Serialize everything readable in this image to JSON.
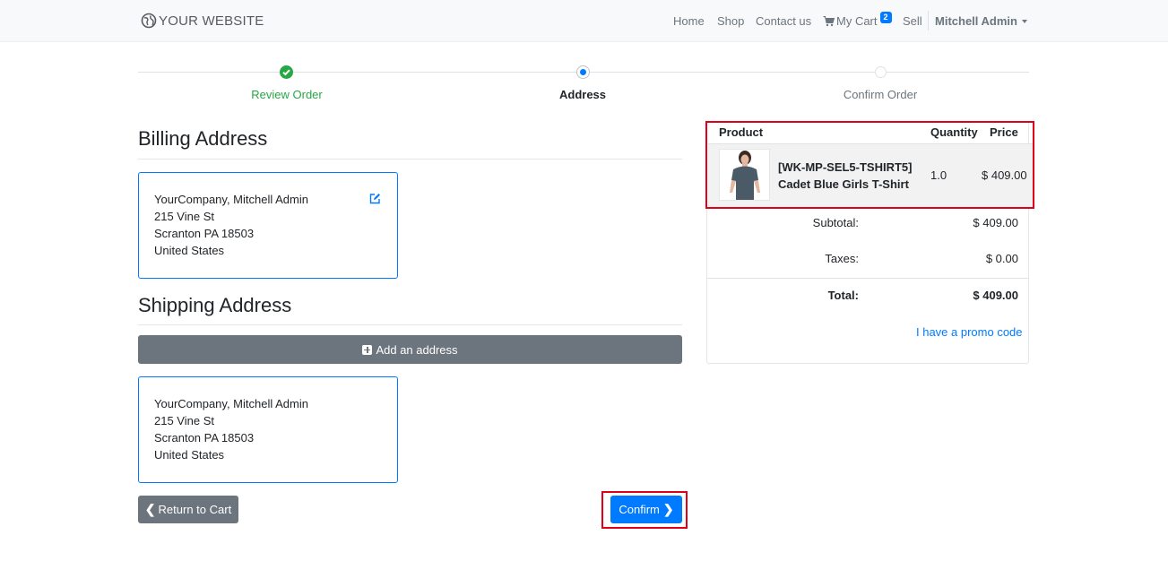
{
  "navbar": {
    "brand": "YOUR WEBSITE",
    "links": [
      "Home",
      "Shop",
      "Contact us"
    ],
    "cart_label": "My Cart",
    "cart_count": "2",
    "sell": "Sell",
    "user": "Mitchell Admin"
  },
  "wizard": {
    "steps": [
      {
        "label": "Review Order",
        "state": "done"
      },
      {
        "label": "Address",
        "state": "active"
      },
      {
        "label": "Confirm Order",
        "state": "pending"
      }
    ]
  },
  "billing": {
    "title": "Billing Address",
    "lines": [
      "YourCompany, Mitchell Admin",
      "215 Vine St",
      "Scranton PA 18503",
      "United States"
    ]
  },
  "shipping": {
    "title": "Shipping Address",
    "add_button": "Add an address",
    "lines": [
      "YourCompany, Mitchell Admin",
      "215 Vine St",
      "Scranton PA 18503",
      "United States"
    ]
  },
  "actions": {
    "return": "Return to Cart",
    "confirm": "Confirm"
  },
  "summary": {
    "headers": {
      "product": "Product",
      "quantity": "Quantity",
      "price": "Price"
    },
    "item": {
      "code": "[WK-MP-SEL5-TSHIRT5]",
      "name": "Cadet Blue Girls T-Shirt",
      "quantity": "1.0",
      "price": "$ 409.00"
    },
    "subtotal_label": "Subtotal:",
    "subtotal": "$ 409.00",
    "taxes_label": "Taxes:",
    "taxes": "$ 0.00",
    "total_label": "Total:",
    "total": "$ 409.00",
    "promo": "I have a promo code"
  },
  "colors": {
    "primary": "#007bff",
    "success": "#28a745",
    "secondary": "#6c757d",
    "highlight": "#e0001b"
  }
}
